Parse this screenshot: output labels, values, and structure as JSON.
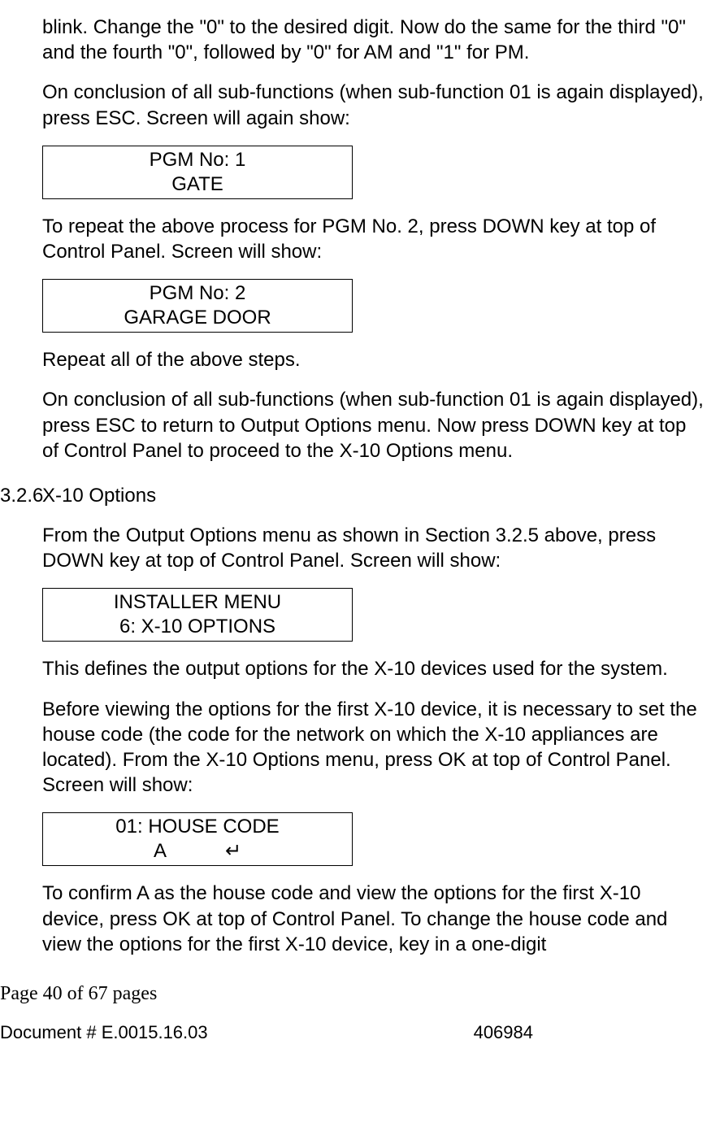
{
  "paragraphs": {
    "p1": "blink. Change the \"0\" to the desired digit. Now do the same for the third \"0\" and the fourth \"0\", followed by \"0\" for AM and \"1\" for PM.",
    "p2": "On conclusion of all sub-functions (when sub-function 01 is again displayed), press ESC. Screen will again show:",
    "p3": "To repeat the above process for PGM No. 2, press DOWN key at top of Control Panel. Screen will show:",
    "p4": "Repeat all of the above steps.",
    "p5": "On conclusion of all sub-functions (when sub-function 01 is again displayed), press ESC to return to Output Options menu. Now press DOWN key at top of Control Panel to proceed to the X-10 Options menu.",
    "p6": "From the Output Options menu as shown in Section 3.2.5 above, press DOWN key at top of Control Panel. Screen will show:",
    "p7": "This defines the output options for the X-10 devices used for the system.",
    "p8": "Before viewing the options for the first X-10 device, it is necessary to set the house code (the code for the network on which the X-10 appliances are located). From the X-10 Options menu, press OK at top of Control Panel. Screen will show:",
    "p9": "To confirm A as the house code and view the options for the first X-10 device, press OK at top of Control Panel. To change the house code and view the options for the first X-10 device, key in a one-digit"
  },
  "section": {
    "number": "3.2.6",
    "title": "X-10 Options"
  },
  "screens": {
    "s1": {
      "line1": "PGM No: 1",
      "line2": "GATE"
    },
    "s2": {
      "line1": "PGM No: 2",
      "line2": "GARAGE DOOR"
    },
    "s3": {
      "line1": "INSTALLER MENU",
      "line2": "6: X-10 OPTIONS"
    },
    "s4": {
      "line1": "01: HOUSE CODE",
      "line2": "A   ↵"
    }
  },
  "footer": {
    "page": "Page 40 of  67 pages",
    "doc": "Document # E.0015.16.03",
    "code": "406984"
  }
}
